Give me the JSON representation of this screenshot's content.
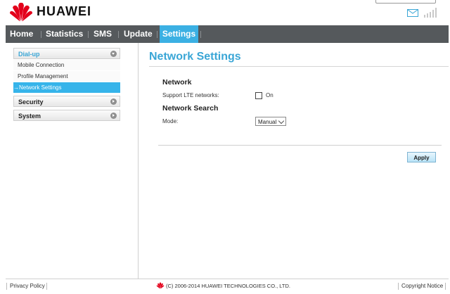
{
  "header": {
    "brand": "HUAWEI",
    "icons": {
      "logo": "huawei-logo",
      "mail": "mail-icon",
      "signal": "signal-icon"
    },
    "colors": {
      "logo_red": "#e3001b",
      "mail_blue": "#3aa6d6"
    }
  },
  "nav": {
    "items": [
      {
        "label": "Home"
      },
      {
        "label": "Statistics"
      },
      {
        "label": "SMS"
      },
      {
        "label": "Update"
      },
      {
        "label": "Settings",
        "active": true
      }
    ],
    "colors": {
      "bar": "#55595c",
      "active": "#3bb0e3"
    }
  },
  "sidebar": {
    "sections": [
      {
        "label": "Dial-up",
        "expanded": true,
        "icon": "chevron-down-icon",
        "items": [
          {
            "label": "Mobile Connection"
          },
          {
            "label": "Profile Management"
          },
          {
            "label": "Network Settings",
            "active": true,
            "prefix": "→"
          }
        ]
      },
      {
        "label": "Security",
        "expanded": false,
        "icon": "chevron-right-icon"
      },
      {
        "label": "System",
        "expanded": false,
        "icon": "chevron-right-icon"
      }
    ]
  },
  "main": {
    "title": "Network Settings",
    "network": {
      "heading": "Network",
      "lte_label": "Support LTE networks:",
      "lte_checked": false,
      "lte_option": "On"
    },
    "network_search": {
      "heading": "Network Search",
      "mode_label": "Mode:",
      "mode_value": "Manual"
    },
    "apply_label": "Apply"
  },
  "footer": {
    "privacy": "Privacy Policy",
    "copyright": "(C) 2006-2014 HUAWEI TECHNOLOGIES CO., LTD.",
    "notice": "Copyright Notice"
  }
}
